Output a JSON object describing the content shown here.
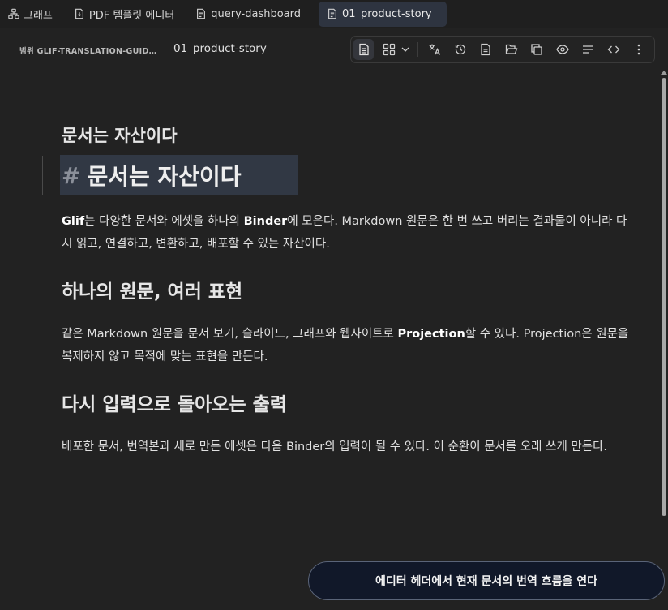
{
  "tabs": [
    {
      "label": "그래프",
      "icon": "graph-icon",
      "active": false
    },
    {
      "label": "PDF 템플릿 에디터",
      "icon": "pdf-file-icon",
      "active": false
    },
    {
      "label": "query-dashboard",
      "icon": "document-icon",
      "active": false
    },
    {
      "label": "01_product-story",
      "icon": "document-icon",
      "active": true
    }
  ],
  "header": {
    "breadcrumb": "범위 GLIF-TRANSLATION-GUID…",
    "title": "01_product-story"
  },
  "toolbar": {
    "icons": [
      "document-view-icon",
      "grid-view-icon",
      "chevron-down-icon",
      "translate-icon",
      "history-icon",
      "file-text-icon",
      "folder-open-icon",
      "copy-icon",
      "eye-icon",
      "align-lines-icon",
      "code-icon",
      "more-vertical-icon"
    ]
  },
  "document": {
    "section_title": "문서는 자산이다",
    "h1_hash": "#",
    "h1": "문서는 자산이다",
    "p1": {
      "b1": "Glif",
      "t1": "는 다양한 문서와 에셋을 하나의 ",
      "b2": "Binder",
      "t2": "에 모은다. Markdown 원문은 한 번 쓰고 버리는 결과물이 아니라 다시 읽고, 연결하고, 변환하고, 배포할 수 있는 자산이다."
    },
    "h2_1": "하나의 원문, 여러 표현",
    "p2": {
      "t1": "같은 Markdown 원문을 문서 보기, 슬라이드, 그래프와 웹사이트로 ",
      "b1": "Projection",
      "t2": "할 수 있다. Projection은 원문을 복제하지 않고 목적에 맞는 표현을 만든다."
    },
    "h2_2": "다시 입력으로 돌아오는 출력",
    "p3": "배포한 문서, 번역본과 새로 만든 에셋은 다음 Binder의 입력이 될 수 있다. 이 순환이 문서를 오래 쓰게 만든다."
  },
  "cta": {
    "label": "에디터 헤더에서 현재 문서의 번역 흐름을 연다"
  }
}
